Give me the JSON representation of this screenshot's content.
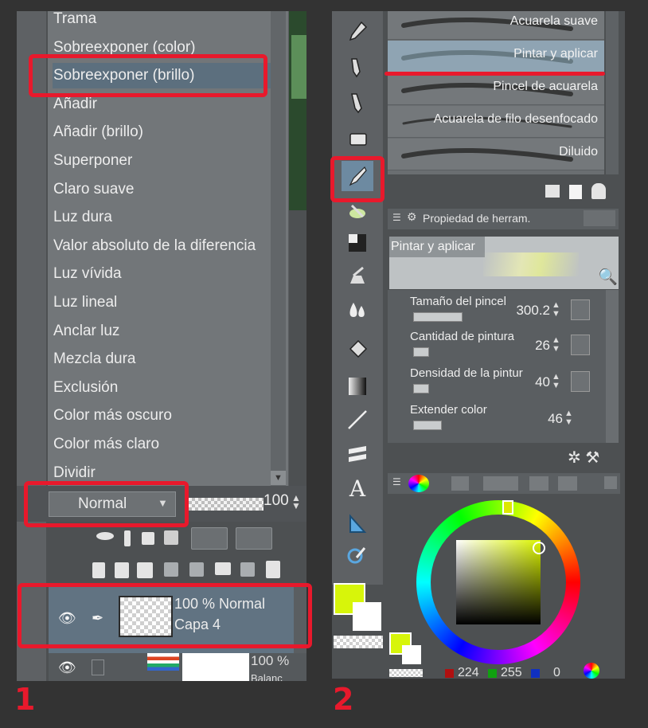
{
  "panel1": {
    "blend_menu": {
      "items": [
        {
          "label": "Trama"
        },
        {
          "label": "Sobreexponer (color)"
        },
        {
          "label": "Sobreexponer (brillo)",
          "selected": true
        },
        {
          "label": "Añadir"
        },
        {
          "label": "Añadir (brillo)"
        },
        {
          "label": "Superponer"
        },
        {
          "label": "Claro suave"
        },
        {
          "label": "Luz dura"
        },
        {
          "label": "Valor absoluto de la diferencia"
        },
        {
          "label": "Luz vívida"
        },
        {
          "label": "Luz lineal"
        },
        {
          "label": "Anclar luz"
        },
        {
          "label": "Mezcla dura"
        },
        {
          "label": "Exclusión"
        },
        {
          "label": "Color más oscuro"
        },
        {
          "label": "Color más claro"
        },
        {
          "label": "Dividir"
        }
      ]
    },
    "blend_mode_value": "Normal",
    "opacity_value": "100",
    "layer": {
      "info": "100 % Normal",
      "name": "Capa 4"
    },
    "layer2": {
      "info": "100 %",
      "name": "Balanc"
    }
  },
  "panel2": {
    "brushes": [
      {
        "label": "Acuarela suave"
      },
      {
        "label": "Pintar y aplicar",
        "selected": true
      },
      {
        "label": "Pincel de acuarela"
      },
      {
        "label": "Acuarela de filo desenfocado"
      },
      {
        "label": "Diluido"
      }
    ],
    "tool_property_title": "Propiedad de herram.",
    "preview_label": "Pintar y aplicar",
    "params": [
      {
        "label": "Tamaño del pincel",
        "value": "300.2"
      },
      {
        "label": "Cantidad de pintura",
        "value": "26"
      },
      {
        "label": "Densidad de la pintur",
        "value": "40"
      },
      {
        "label": "Extender color",
        "value": "46"
      }
    ],
    "color": {
      "main": "#d7f50a",
      "r": "224",
      "g": "255",
      "b": "0"
    }
  },
  "labels": {
    "one": "1",
    "two": "2"
  }
}
